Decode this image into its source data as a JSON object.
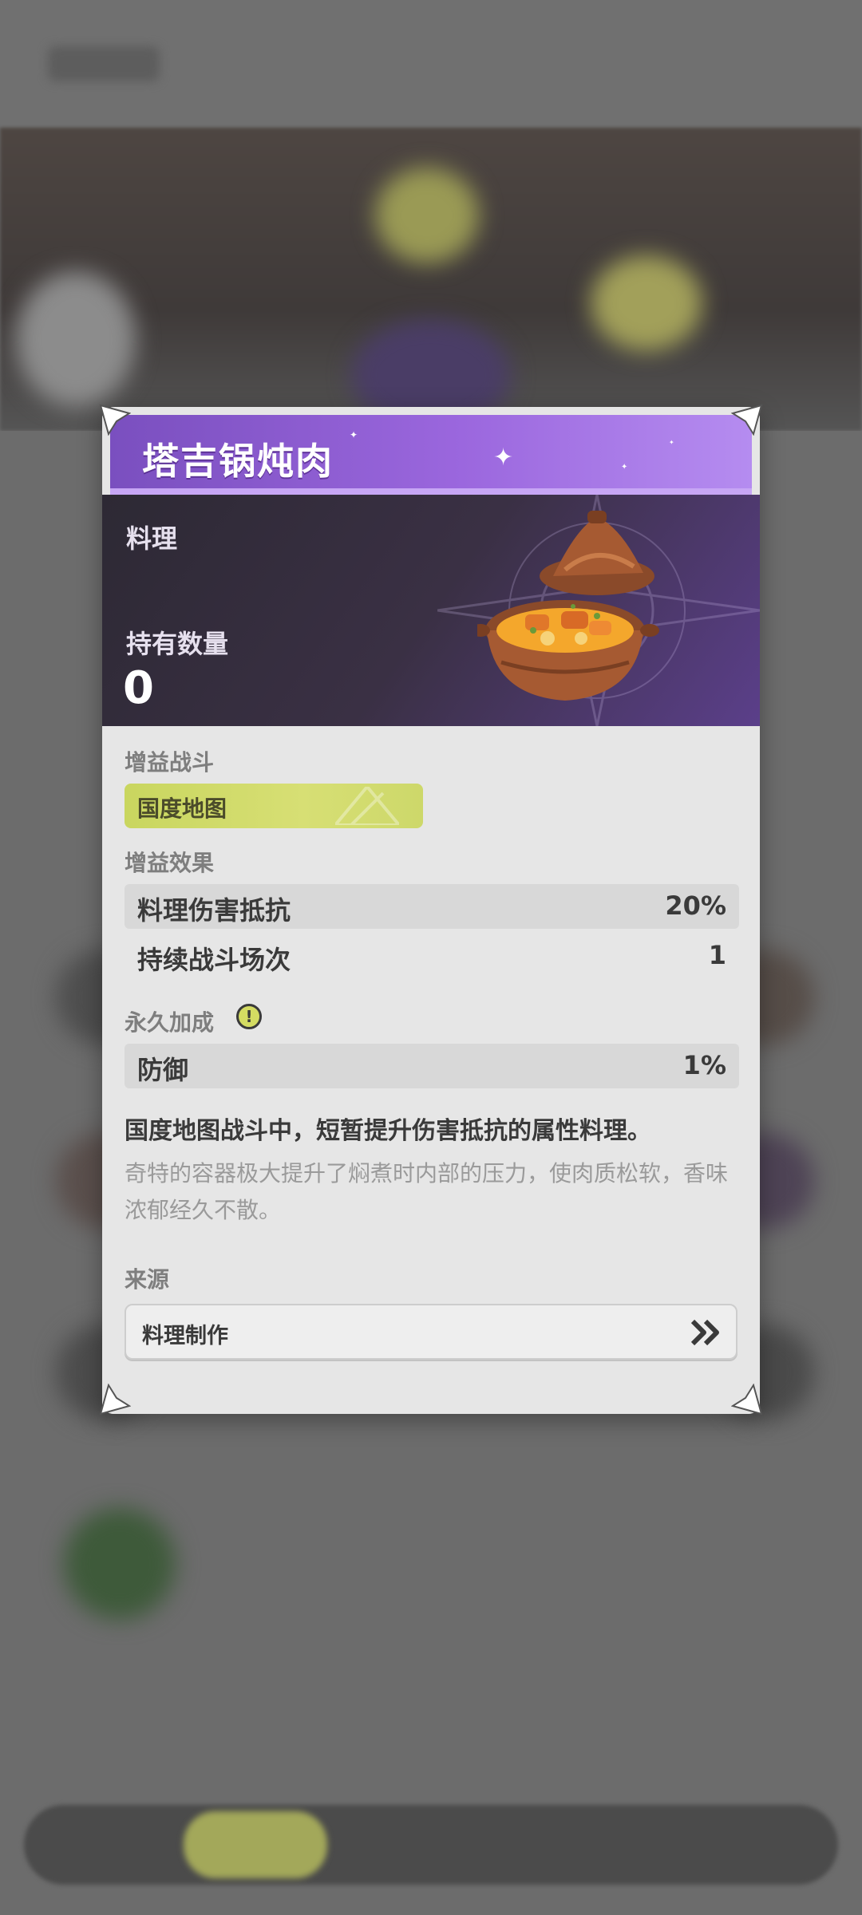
{
  "item": {
    "name": "塔吉锅炖肉",
    "category": "料理",
    "owned_label": "持有数量",
    "owned_count": "0"
  },
  "buff_battle": {
    "label": "增益战斗",
    "tag": "国度地图"
  },
  "buff_effect": {
    "label": "增益效果",
    "rows": [
      {
        "name": "料理伤害抵抗",
        "value": "20%"
      },
      {
        "name": "持续战斗场次",
        "value": "1"
      }
    ]
  },
  "permanent_bonus": {
    "label": "永久加成",
    "info_icon": "!",
    "rows": [
      {
        "name": "防御",
        "value": "1%"
      }
    ]
  },
  "description": {
    "main": "国度地图战斗中，短暂提升伤害抵抗的属性料理。",
    "flavor": "奇特的容器极大提升了焖煮时内部的压力，使肉质松软，香味浓郁经久不散。"
  },
  "source": {
    "label": "来源",
    "button_label": "料理制作"
  },
  "colors": {
    "title_purple": "#9b67de",
    "tag_yellow": "#d7df74",
    "card_bg": "#e6e6e6",
    "header_dark": "#2d2934"
  },
  "icons": {
    "corner": "corner-ornament-icon",
    "chevron": "double-chevron-right-icon",
    "info": "exclamation-icon",
    "food": "tagine-stew-icon"
  }
}
